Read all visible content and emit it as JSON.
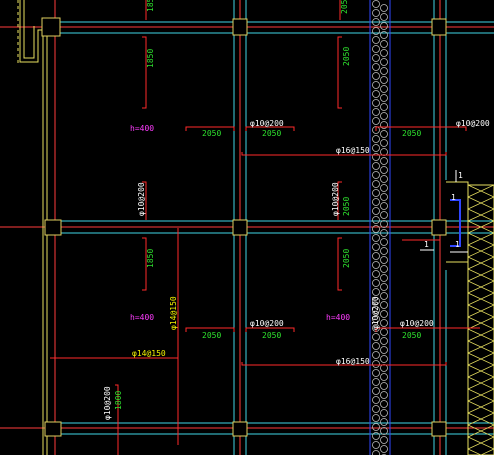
{
  "drawing": {
    "colors": {
      "background": "#000000",
      "axis": "#ff3b3b",
      "beam": "#3fd6e6",
      "column": "#e0d060",
      "wall": "#e8e060",
      "rebar": "#ff2a2a",
      "dim_text": "#2ee12e",
      "label_text": "#ffffff",
      "slab_text": "#ff3cff",
      "section_blue": "#2f47ff"
    },
    "labels": {
      "top_a": "1850",
      "top_b": "2050",
      "top_c": "2050",
      "h1": "h=400",
      "h2": "h=400",
      "h3": "h=400",
      "r1_a": "2050",
      "r1_b": "2050",
      "r1_c": "2050",
      "rebar_1": "φ10@200",
      "rebar_2": "φ10@200",
      "rebar_3": "φ10@200",
      "rebar_4": "φ10@200",
      "rebar_5": "φ10@200",
      "rebar_6": "φ10@200",
      "rebar_7": "φ10@200",
      "rebar_8": "φ10@200",
      "rebar_9": "φ10@200",
      "rebar_long_1": "φ16@150",
      "rebar_long_2": "φ16@150",
      "rebar_14": "φ14@150",
      "rebar_14v": "φ14@150",
      "mid_a": "1850",
      "mid_b": "2050",
      "r2_a": "2050",
      "r2_b": "2050",
      "r2_c": "2050",
      "bottom_a": "1800",
      "sec_1a": "1",
      "sec_1b": "1",
      "sec_1c": "1",
      "sec_1d": "1"
    }
  }
}
